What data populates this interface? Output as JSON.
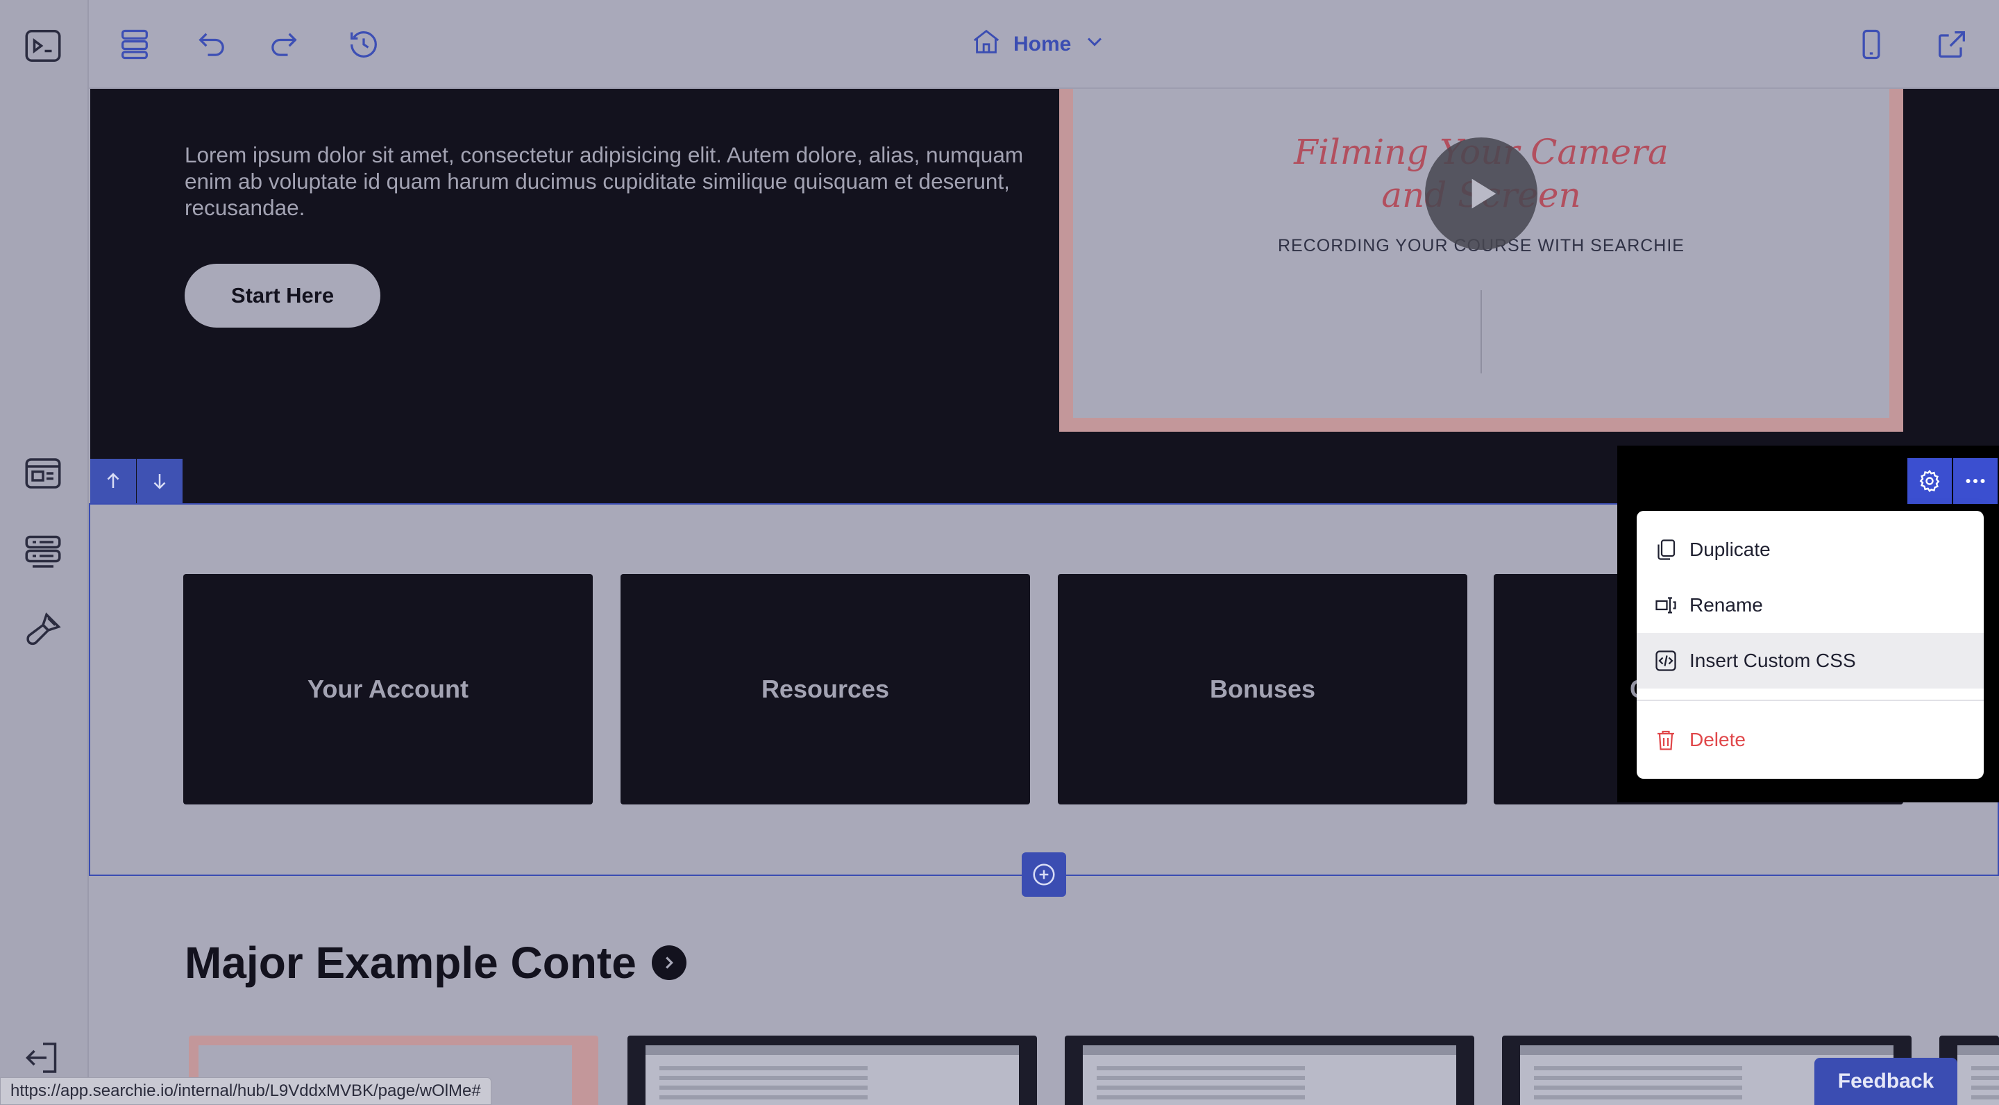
{
  "topbar": {
    "page_name": "Home"
  },
  "hero": {
    "body_text": "Lorem ipsum dolor sit amet, consectetur adipisicing elit. Autem dolore, alias, numquam enim ab voluptate id quam harum ducimus cupiditate similique quisquam et deserunt, recusandae.",
    "cta_label": "Start Here",
    "video": {
      "title_line1": "Filming Your Camera",
      "title_line2": "and Screen",
      "subtitle": "RECORDING YOUR COURSE WITH SEARCHIE"
    }
  },
  "section": {
    "tiles": [
      "Your Account",
      "Resources",
      "Bonuses",
      "C"
    ]
  },
  "menu": {
    "items": [
      {
        "label": "Duplicate",
        "icon": "duplicate-icon"
      },
      {
        "label": "Rename",
        "icon": "rename-icon"
      },
      {
        "label": "Insert Custom CSS",
        "icon": "code-icon"
      },
      {
        "label": "Delete",
        "icon": "trash-icon"
      }
    ]
  },
  "lower": {
    "heading": "Major Example Conte"
  },
  "status_url": "https://app.searchie.io/internal/hub/L9VddxMVBK/page/wOlMe#",
  "feedback_label": "Feedback",
  "colors": {
    "accent": "#3b4db2",
    "dark": "#13121e",
    "overlay": "#a9a9b9",
    "danger": "#e0474a"
  }
}
